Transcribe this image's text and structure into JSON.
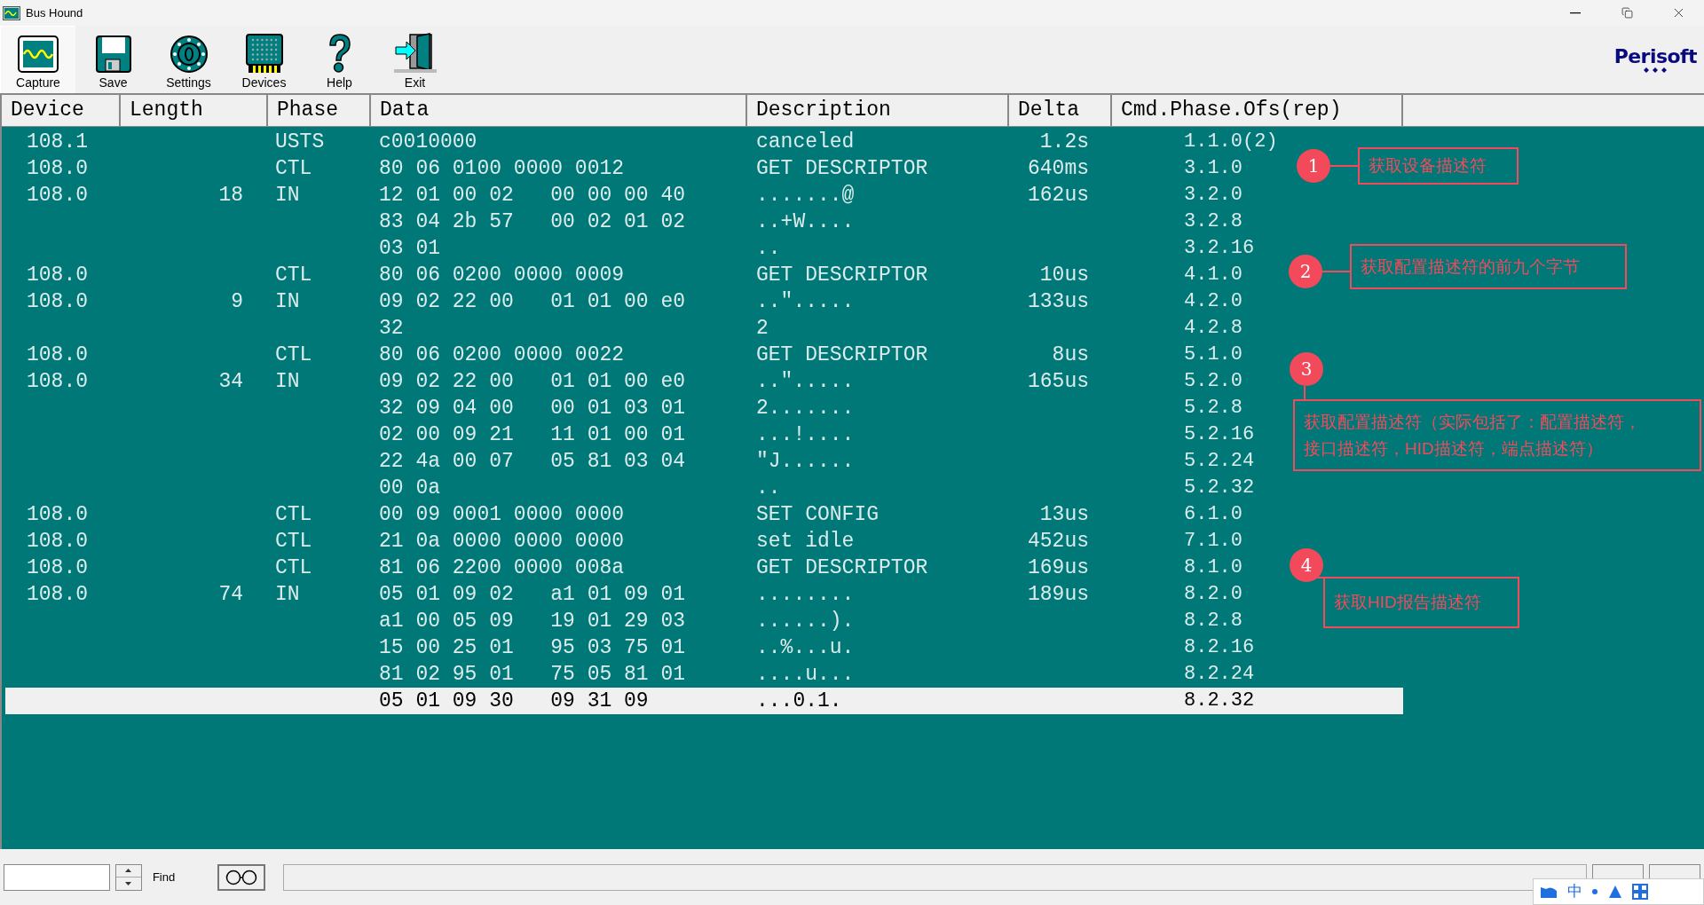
{
  "window": {
    "title": "Bus Hound"
  },
  "toolbar": [
    {
      "label": "Capture",
      "kind": "capture",
      "selected": true
    },
    {
      "label": "Save",
      "kind": "save",
      "selected": false
    },
    {
      "label": "Settings",
      "kind": "settings",
      "selected": false
    },
    {
      "label": "Devices",
      "kind": "devices",
      "selected": false
    },
    {
      "label": "Help",
      "kind": "help",
      "selected": false
    },
    {
      "label": "Exit",
      "kind": "exit",
      "selected": false
    }
  ],
  "logo": "Perisoft",
  "table": {
    "columns": [
      "Device",
      "Length",
      "Phase",
      "Data",
      "Description",
      "Delta",
      "Cmd.Phase.Ofs(rep)"
    ],
    "rows": [
      {
        "device": "108.1",
        "phase": "USTS",
        "data": "c0010000",
        "description": "canceled",
        "delta": "1.2s",
        "cmd": "1.1.0(2)",
        "selected": false
      },
      {
        "device": "108.0",
        "phase": "CTL",
        "data": "80 06 0100 0000 0012",
        "description": "GET DESCRIPTOR",
        "delta": "640ms",
        "cmd": "3.1.0",
        "selected": false
      },
      {
        "device": "108.0",
        "length": "18",
        "phase": "IN",
        "data": "12 01 00 02   00 00 00 40",
        "description": ".......@",
        "delta": "162us",
        "cmd": "3.2.0",
        "selected": false
      },
      {
        "data": "83 04 2b 57   00 02 01 02",
        "description": "..+W....",
        "cmd": "3.2.8",
        "selected": false
      },
      {
        "data": "03 01",
        "description": "..",
        "cmd": "3.2.16",
        "selected": false
      },
      {
        "device": "108.0",
        "phase": "CTL",
        "data": "80 06 0200 0000 0009",
        "description": "GET DESCRIPTOR",
        "delta": "10us",
        "cmd": "4.1.0",
        "selected": false
      },
      {
        "device": "108.0",
        "length": "9",
        "phase": "IN",
        "data": "09 02 22 00   01 01 00 e0",
        "description": "..\".....",
        "delta": "133us",
        "cmd": "4.2.0",
        "selected": false
      },
      {
        "data": "32",
        "description": "2",
        "cmd": "4.2.8",
        "selected": false
      },
      {
        "device": "108.0",
        "phase": "CTL",
        "data": "80 06 0200 0000 0022",
        "description": "GET DESCRIPTOR",
        "delta": "8us",
        "cmd": "5.1.0",
        "selected": false
      },
      {
        "device": "108.0",
        "length": "34",
        "phase": "IN",
        "data": "09 02 22 00   01 01 00 e0",
        "description": "..\".....",
        "delta": "165us",
        "cmd": "5.2.0",
        "selected": false
      },
      {
        "data": "32 09 04 00   00 01 03 01",
        "description": "2.......",
        "cmd": "5.2.8",
        "selected": false
      },
      {
        "data": "02 00 09 21   11 01 00 01",
        "description": "...!....",
        "cmd": "5.2.16",
        "selected": false
      },
      {
        "data": "22 4a 00 07   05 81 03 04",
        "description": "\"J......",
        "cmd": "5.2.24",
        "selected": false
      },
      {
        "data": "00 0a",
        "description": "..",
        "cmd": "5.2.32",
        "selected": false
      },
      {
        "device": "108.0",
        "phase": "CTL",
        "data": "00 09 0001 0000 0000",
        "description": "SET CONFIG",
        "delta": "13us",
        "cmd": "6.1.0",
        "selected": false
      },
      {
        "device": "108.0",
        "phase": "CTL",
        "data": "21 0a 0000 0000 0000",
        "description": "set idle",
        "delta": "452us",
        "cmd": "7.1.0",
        "selected": false
      },
      {
        "device": "108.0",
        "phase": "CTL",
        "data": "81 06 2200 0000 008a",
        "description": "GET DESCRIPTOR",
        "delta": "169us",
        "cmd": "8.1.0",
        "selected": false
      },
      {
        "device": "108.0",
        "length": "74",
        "phase": "IN",
        "data": "05 01 09 02   a1 01 09 01",
        "description": "........",
        "delta": "189us",
        "cmd": "8.2.0",
        "selected": false
      },
      {
        "data": "a1 00 05 09   19 01 29 03",
        "description": "......).",
        "cmd": "8.2.8",
        "selected": false
      },
      {
        "data": "15 00 25 01   95 03 75 01",
        "description": "..%...u.",
        "cmd": "8.2.16",
        "selected": false
      },
      {
        "data": "81 02 95 01   75 05 81 01",
        "description": "....u...",
        "cmd": "8.2.24",
        "selected": false
      },
      {
        "data": "05 01 09 30   09 31 09",
        "description": "...0.1.",
        "cmd": "8.2.32",
        "selected": true
      }
    ]
  },
  "annotations": [
    {
      "number": "1",
      "text": "获取设备描述符"
    },
    {
      "number": "2",
      "text": "获取配置描述符的前九个字节"
    },
    {
      "number": "3",
      "text": "获取配置描述符（实际包括了：配置描述符，接口描述符，HID描述符，端点描述符）"
    },
    {
      "number": "4",
      "text": "获取HID报告描述符"
    }
  ],
  "find": {
    "label": "Find"
  },
  "ime": {
    "mode": "中"
  }
}
